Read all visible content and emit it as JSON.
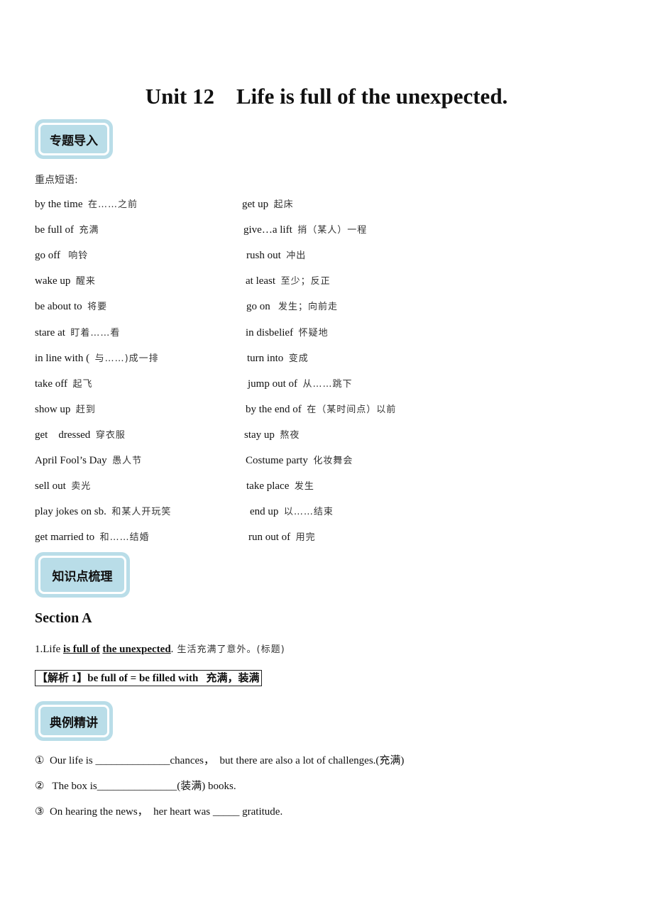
{
  "title": "Unit 12    Life is full of the unexpected.",
  "badges": {
    "intro": "专题导入",
    "knowledge": "知识点梳理",
    "examples": "典例精讲"
  },
  "phrases_label": "重点短语:",
  "phrases_left": [
    {
      "en": "by the time",
      "zh": "在……之前"
    },
    {
      "en": "be full of",
      "zh": "充满"
    },
    {
      "en": "go off ",
      "zh": "响铃"
    },
    {
      "en": "wake up",
      "zh": "醒来"
    },
    {
      "en": "be about to",
      "zh": "将要"
    },
    {
      "en": "stare at",
      "zh": "盯着……看"
    },
    {
      "en": "in line with (",
      "zh": "与……)成一排"
    },
    {
      "en": "take off",
      "zh": "起飞"
    },
    {
      "en": "show up",
      "zh": "赶到"
    },
    {
      "en": "get    dressed",
      "zh": "穿衣服"
    },
    {
      "en": "April Fool’s Day",
      "zh": "愚人节"
    },
    {
      "en": "sell out",
      "zh": "卖光"
    },
    {
      "en": "play jokes on sb.",
      "zh": "和某人开玩笑"
    },
    {
      "en": "get married to",
      "zh": "和……结婚"
    }
  ],
  "phrases_right": [
    {
      "en": "get up",
      "zh": "起床"
    },
    {
      "en": "give…a lift",
      "zh": "捎（某人）一程"
    },
    {
      "en": "rush out",
      "zh": "冲出"
    },
    {
      "en": "at least",
      "zh": "至少；反正"
    },
    {
      "en": "go on ",
      "zh": "发生；向前走"
    },
    {
      "en": "in disbelief",
      "zh": "怀疑地"
    },
    {
      "en": "turn into",
      "zh": "变成"
    },
    {
      "en": "jump out of",
      "zh": "从……跳下"
    },
    {
      "en": "by the end of",
      "zh": "在（某时间点）以前"
    },
    {
      "en": "stay up",
      "zh": "熬夜"
    },
    {
      "en": "Costume party",
      "zh": "化妆舞会"
    },
    {
      "en": "take place",
      "zh": "发生"
    },
    {
      "en": "end up",
      "zh": "以……结束"
    },
    {
      "en": "run out of",
      "zh": "用完"
    }
  ],
  "section_title": "Section A",
  "point1": {
    "prefix": "1.Life ",
    "underline1": "is full of",
    "space": " ",
    "underline2": "the unexpected",
    "suffix": ".",
    "zh": " 生活充满了意外。(标题)"
  },
  "analysis1": "【解析 1】be full of = be filled with   充满，装满",
  "examples": [
    {
      "num": "①",
      "text": "Our life is ______________chances，  but there are also a lot of challenges.(充满)"
    },
    {
      "num": "②",
      "text": " The box is_______________(装满) books."
    },
    {
      "num": "③",
      "text": "On hearing the news，  her heart was _____ gratitude."
    }
  ]
}
